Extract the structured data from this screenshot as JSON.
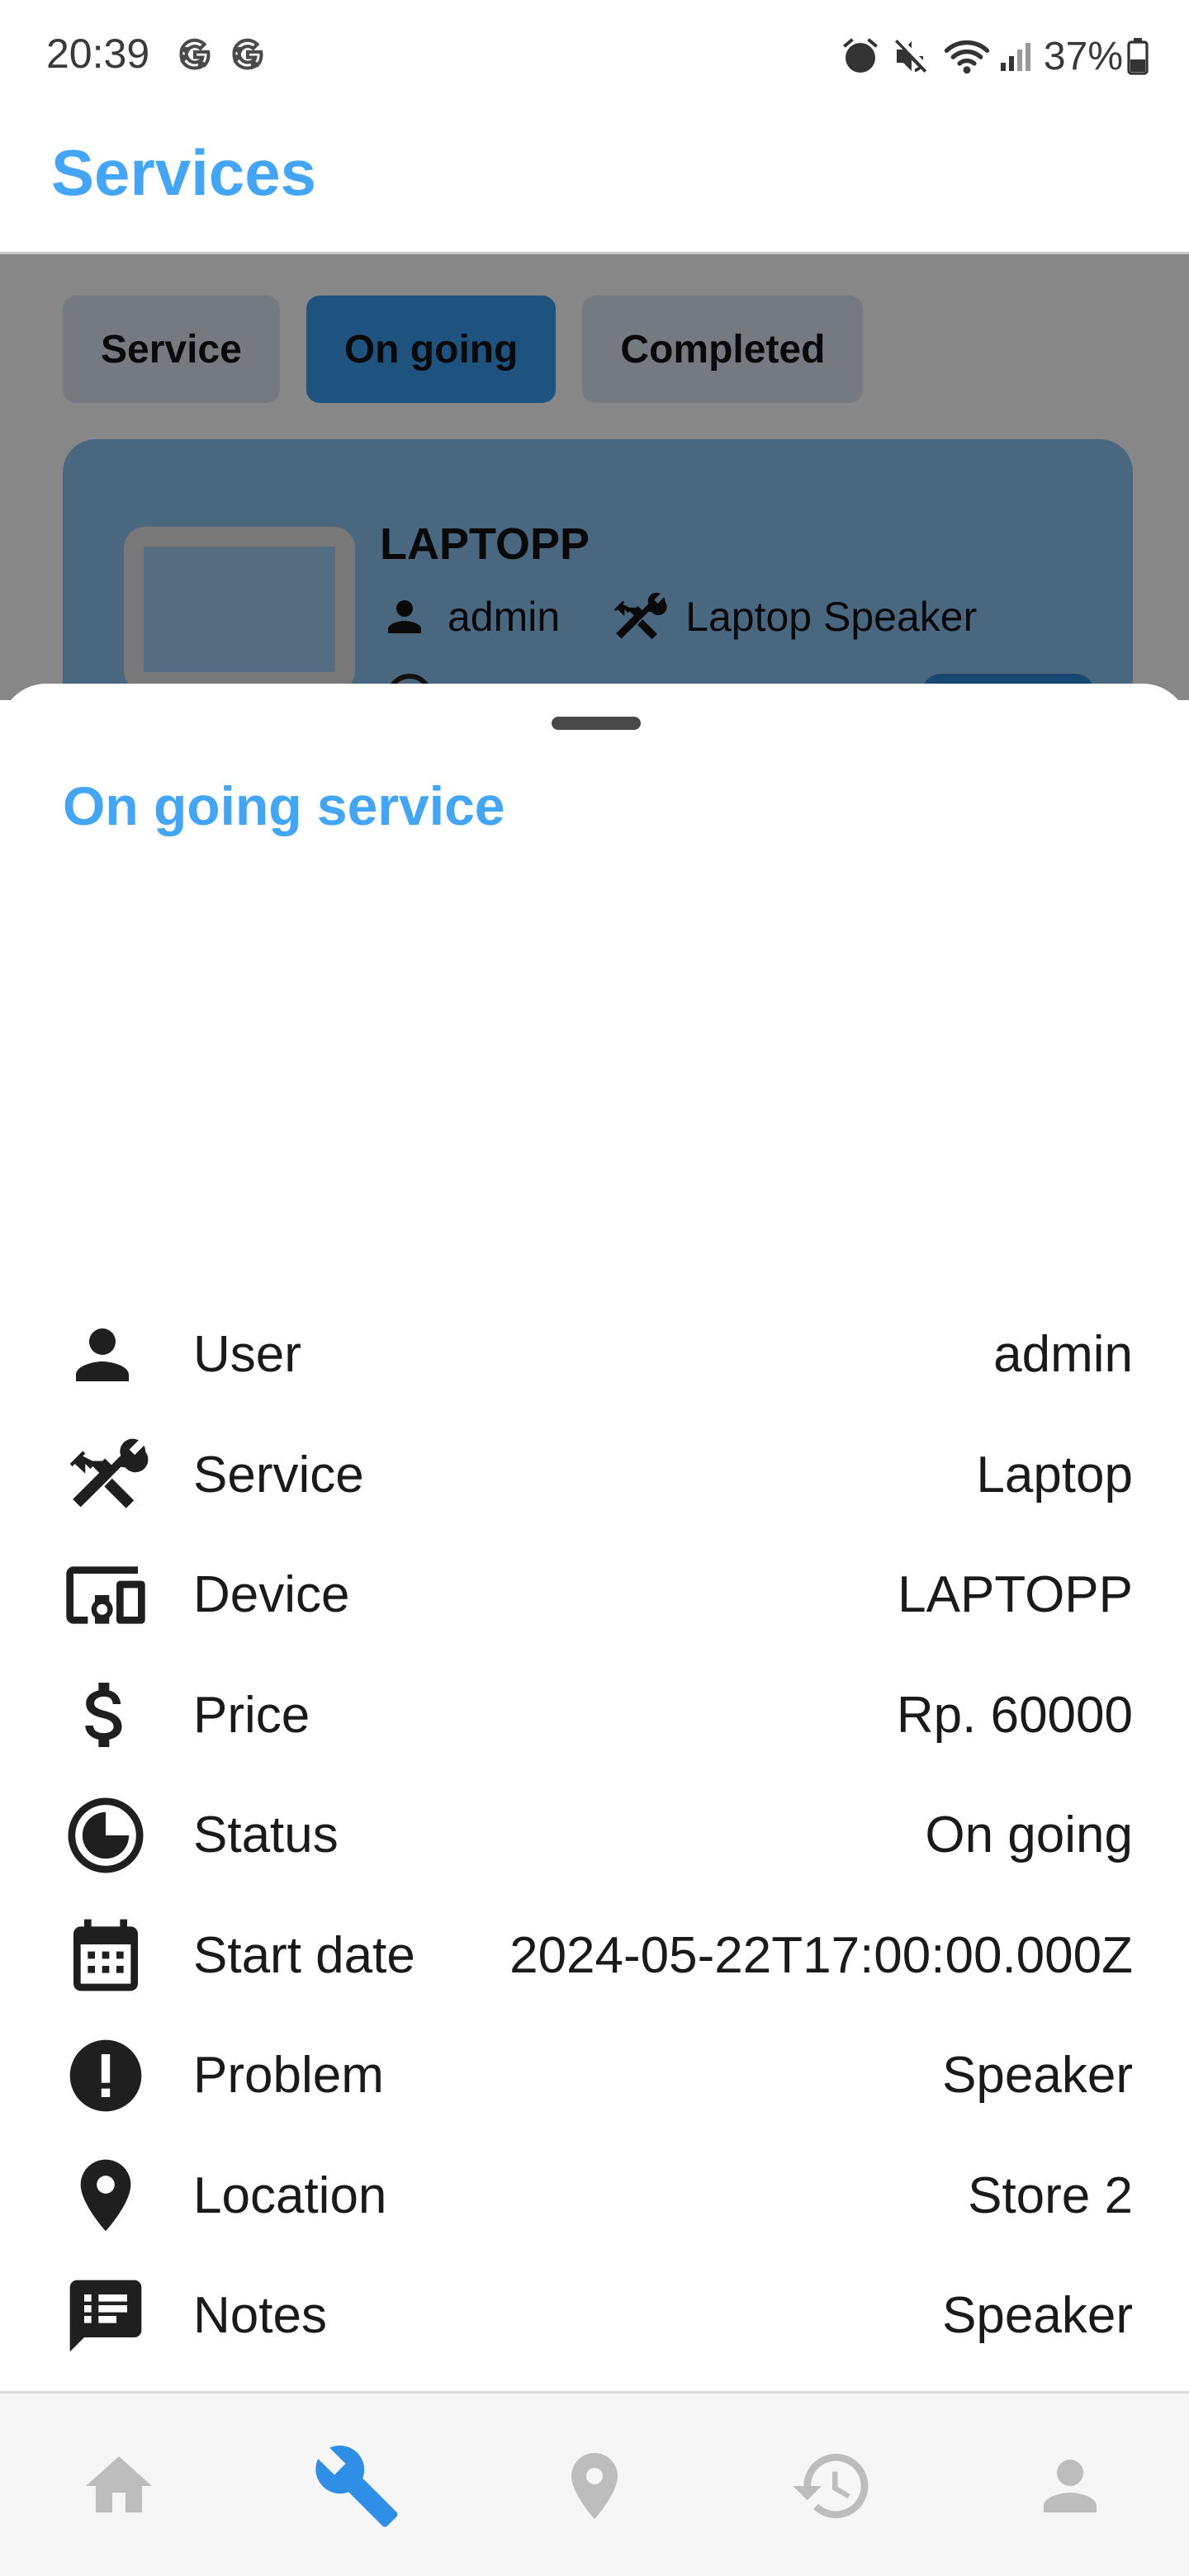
{
  "status_bar": {
    "time": "20:39",
    "notification_icons": [
      "google-icon",
      "google-icon"
    ],
    "system_icons": [
      "alarm-icon",
      "mute-icon",
      "wifi-icon",
      "signal-icon"
    ],
    "battery_percent": "37%"
  },
  "app_bar": {
    "title": "Services",
    "title_color": "#42a5f5"
  },
  "tabs": [
    {
      "label": "Service",
      "active": false
    },
    {
      "label": "On going",
      "active": true
    },
    {
      "label": "Completed",
      "active": false
    }
  ],
  "card": {
    "title": "LAPTOPP",
    "user": "admin",
    "service": "Laptop Speaker"
  },
  "sheet": {
    "title": "On going service",
    "details": [
      {
        "icon": "person-icon",
        "label": "User",
        "value": "admin"
      },
      {
        "icon": "tools-icon",
        "label": "Service",
        "value": "Laptop"
      },
      {
        "icon": "devices-icon",
        "label": "Device",
        "value": "LAPTOPP"
      },
      {
        "icon": "dollar-icon",
        "label": "Price",
        "value": "Rp. 60000"
      },
      {
        "icon": "status-clock-icon",
        "label": "Status",
        "value": "On going"
      },
      {
        "icon": "calendar-icon",
        "label": "Start date",
        "value": "2024-05-22T17:00:00.000Z"
      },
      {
        "icon": "alert-icon",
        "label": "Problem",
        "value": "Speaker"
      },
      {
        "icon": "location-pin-icon",
        "label": "Location",
        "value": "Store 2"
      },
      {
        "icon": "notes-icon",
        "label": "Notes",
        "value": "Speaker"
      }
    ]
  },
  "bottom_nav": [
    {
      "icon": "home-icon",
      "active": false
    },
    {
      "icon": "wrench-icon",
      "active": true
    },
    {
      "icon": "location-pin-icon",
      "active": false
    },
    {
      "icon": "history-icon",
      "active": false
    },
    {
      "icon": "account-icon",
      "active": false
    }
  ],
  "colors": {
    "accent": "#42a5f5",
    "nav_active": "#2f8fe6",
    "nav_inactive": "#bdbdbd"
  }
}
